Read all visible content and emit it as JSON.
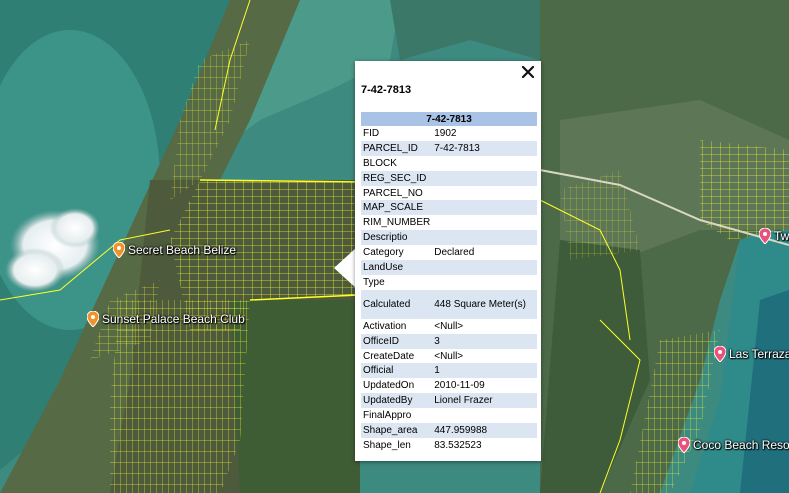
{
  "colors": {
    "parcel_lines": "#ffff2a",
    "popup_header": "#a9c3e6",
    "row_alt": "#dce6f3",
    "pin_orange": "#f0922d",
    "pin_pink": "#e9527a"
  },
  "places": [
    {
      "name": "Secret Beach Belize",
      "icon": "orange-map-pin-icon"
    },
    {
      "name": "Sunset Palace Beach Club",
      "icon": "orange-map-pin-icon"
    },
    {
      "name": "Two",
      "icon": "pink-map-pin-icon"
    },
    {
      "name": "Las Terraza",
      "icon": "pink-map-pin-icon"
    },
    {
      "name": "Coco Beach Reso",
      "icon": "pink-map-pin-icon"
    }
  ],
  "popup": {
    "title": "7-42-7813",
    "header": "7-42-7813",
    "close_icon": "close-x-icon",
    "rows": [
      {
        "key": "FID",
        "value": "1902"
      },
      {
        "key": "PARCEL_ID",
        "value": "7-42-7813"
      },
      {
        "key": "BLOCK",
        "value": ""
      },
      {
        "key": "REG_SEC_ID",
        "value": ""
      },
      {
        "key": "PARCEL_NO",
        "value": ""
      },
      {
        "key": "MAP_SCALE",
        "value": ""
      },
      {
        "key": "RIM_NUMBER",
        "value": ""
      },
      {
        "key": "Descriptio",
        "value": ""
      },
      {
        "key": "Category",
        "value": "Declared"
      },
      {
        "key": "LandUse",
        "value": ""
      },
      {
        "key": "Type",
        "value": ""
      },
      {
        "key": "Calculated",
        "value": "448 Square Meter(s)"
      },
      {
        "key": "Activation",
        "value": "<Null>"
      },
      {
        "key": "OfficeID",
        "value": "3"
      },
      {
        "key": "CreateDate",
        "value": "<Null>"
      },
      {
        "key": "Official",
        "value": "1"
      },
      {
        "key": "UpdatedOn",
        "value": "2010-11-09"
      },
      {
        "key": "UpdatedBy",
        "value": "Lionel Frazer"
      },
      {
        "key": "FinalAppro",
        "value": ""
      },
      {
        "key": "Shape_area",
        "value": "447.959988"
      },
      {
        "key": "Shape_len",
        "value": "83.532523"
      }
    ]
  }
}
